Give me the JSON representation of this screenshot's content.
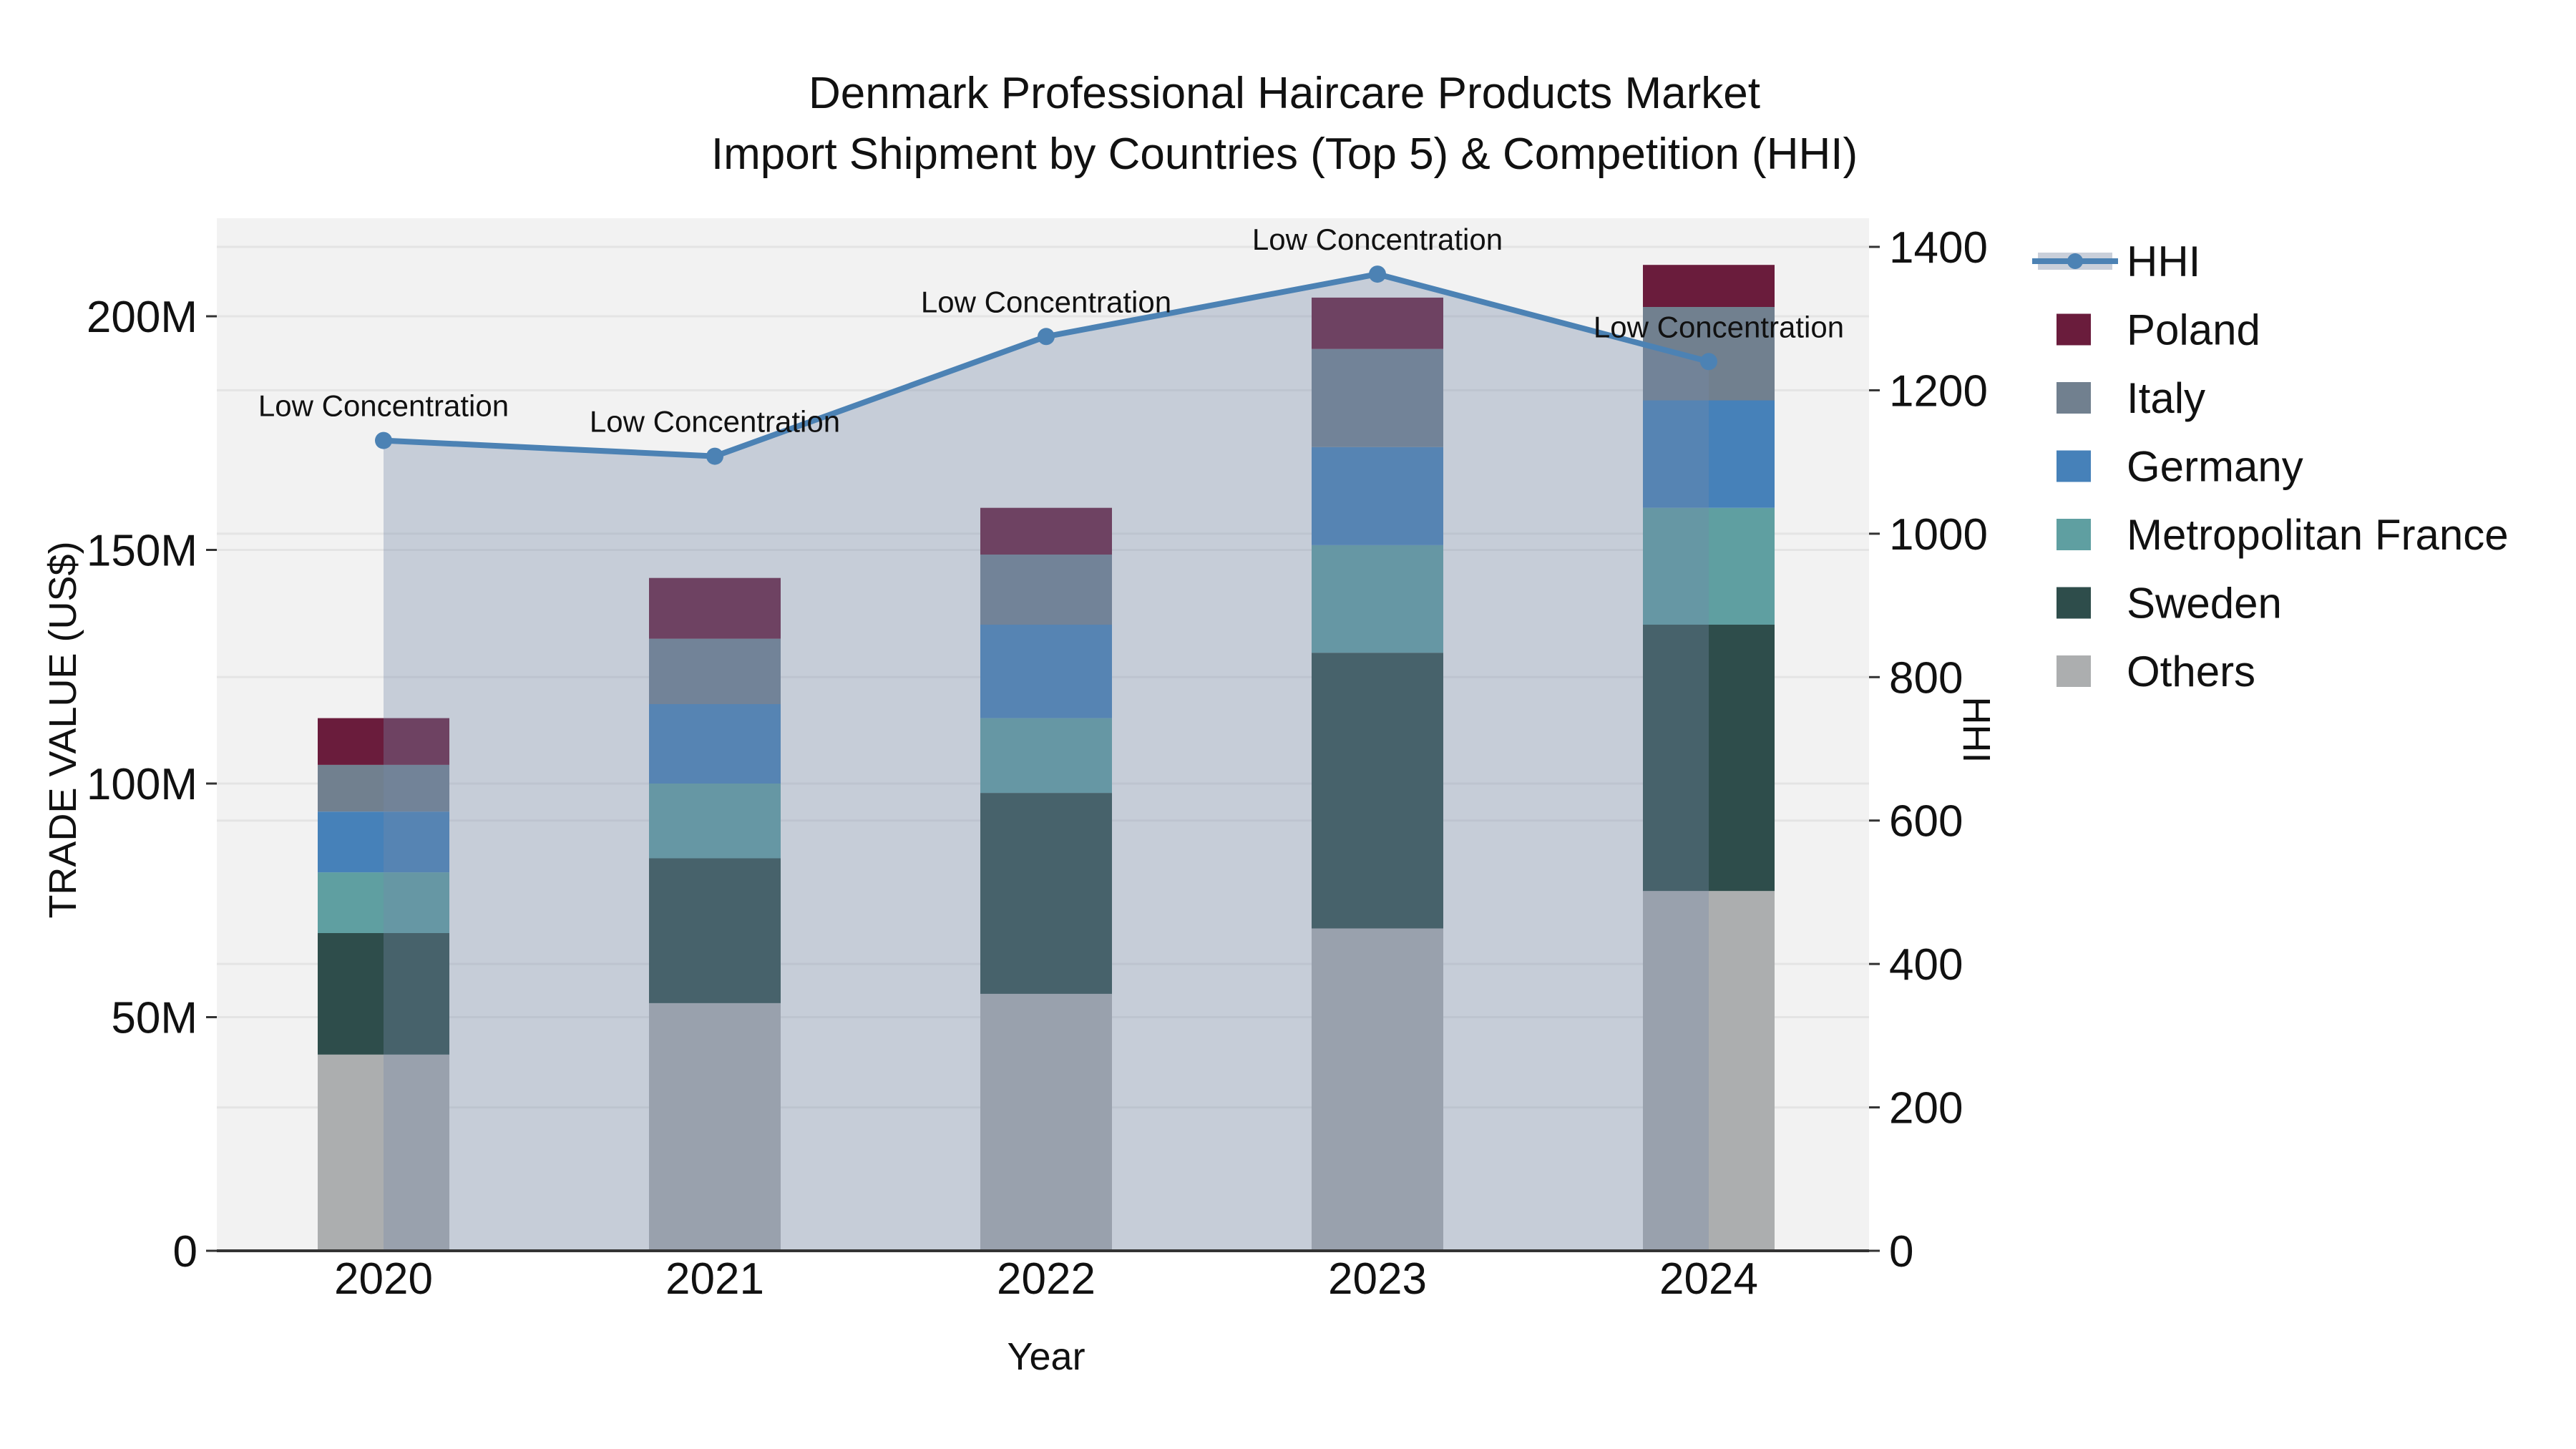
{
  "title": {
    "line1": "Denmark Professional Haircare Products Market",
    "line2": "Import Shipment by Countries (Top 5) & Competition (HHI)"
  },
  "axes": {
    "x": {
      "label": "Year",
      "ticks": [
        "2020",
        "2021",
        "2022",
        "2023",
        "2024"
      ]
    },
    "y_left": {
      "label": "TRADE VALUE (US$)",
      "ticks": [
        {
          "label": "0",
          "value": 0
        },
        {
          "label": "50M",
          "value": 50
        },
        {
          "label": "100M",
          "value": 100
        },
        {
          "label": "150M",
          "value": 150
        },
        {
          "label": "200M",
          "value": 200
        }
      ]
    },
    "y_right": {
      "label": "HHI",
      "ticks": [
        {
          "label": "0",
          "value": 0
        },
        {
          "label": "200",
          "value": 200
        },
        {
          "label": "400",
          "value": 400
        },
        {
          "label": "600",
          "value": 600
        },
        {
          "label": "800",
          "value": 800
        },
        {
          "label": "1000",
          "value": 1000
        },
        {
          "label": "1200",
          "value": 1200
        },
        {
          "label": "1400",
          "value": 1400
        }
      ]
    }
  },
  "legend": {
    "items": [
      {
        "label": "HHI",
        "type": "line",
        "color": "#4C82B4",
        "band": "#C9CFDA"
      },
      {
        "label": "Poland",
        "type": "swatch",
        "color": "#6A1C3C"
      },
      {
        "label": "Italy",
        "type": "swatch",
        "color": "#71808F"
      },
      {
        "label": "Germany",
        "type": "swatch",
        "color": "#4681B9"
      },
      {
        "label": "Metropolitan France",
        "type": "swatch",
        "color": "#5F9FA1"
      },
      {
        "label": "Sweden",
        "type": "swatch",
        "color": "#2E4D4B"
      },
      {
        "label": "Others",
        "type": "swatch",
        "color": "#ACAEAF"
      }
    ]
  },
  "colors": {
    "plot_bg": "#F2F2F2",
    "grid": "#E4E4E4",
    "axis_line": "#333333",
    "text": "#111111",
    "hhi_line": "#4C82B4",
    "hhi_fill": "rgba(118,138,168,0.35)"
  },
  "chart_data": {
    "type": "bar",
    "subtype": "stacked-bars-with-line",
    "title": "Denmark Professional Haircare Products Market — Import Shipment by Countries (Top 5) & Competition (HHI)",
    "xlabel": "Year",
    "ylabel_left": "TRADE VALUE (US$)",
    "ylabel_right": "HHI",
    "categories": [
      "2020",
      "2021",
      "2022",
      "2023",
      "2024"
    ],
    "bar_value_unit": "M US$",
    "ylim_left": [
      0,
      221
    ],
    "ylim_right": [
      0,
      1403
    ],
    "grid": "on",
    "legend_position": "right",
    "series": [
      {
        "name": "Others",
        "type": "bar",
        "color": "#ACAEAF",
        "values": [
          42,
          53,
          55,
          69,
          77
        ]
      },
      {
        "name": "Sweden",
        "type": "bar",
        "color": "#2E4D4B",
        "values": [
          26,
          31,
          43,
          59,
          57
        ]
      },
      {
        "name": "Metropolitan France",
        "type": "bar",
        "color": "#5F9FA1",
        "values": [
          13,
          16,
          16,
          23,
          25
        ]
      },
      {
        "name": "Germany",
        "type": "bar",
        "color": "#4681B9",
        "values": [
          13,
          17,
          20,
          21,
          23
        ]
      },
      {
        "name": "Italy",
        "type": "bar",
        "color": "#71808F",
        "values": [
          10,
          14,
          15,
          21,
          20
        ]
      },
      {
        "name": "Poland",
        "type": "bar",
        "color": "#6A1C3C",
        "values": [
          10,
          13,
          10,
          11,
          9
        ]
      }
    ],
    "bar_totals": [
      114,
      144,
      159,
      204,
      211
    ],
    "line": {
      "name": "HHI",
      "axis": "right",
      "color": "#4C82B4",
      "fill_to_zero": true,
      "values": [
        1130,
        1108,
        1275,
        1362,
        1240
      ],
      "point_annotations": [
        "Low Concentration",
        "Low Concentration",
        "Low Concentration",
        "Low Concentration",
        "Low Concentration"
      ]
    }
  }
}
